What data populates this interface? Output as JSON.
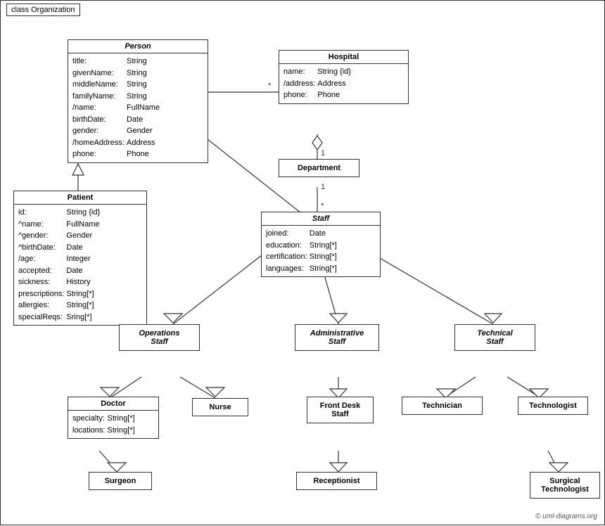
{
  "title": "class Organization",
  "copyright": "© uml-diagrams.org",
  "classes": {
    "person": {
      "name": "Person",
      "italic": true,
      "attributes": [
        [
          "title:",
          "String"
        ],
        [
          "givenName:",
          "String"
        ],
        [
          "middleName:",
          "String"
        ],
        [
          "familyName:",
          "String"
        ],
        [
          "/name:",
          "FullName"
        ],
        [
          "birthDate:",
          "Date"
        ],
        [
          "gender:",
          "Gender"
        ],
        [
          "/homeAddress:",
          "Address"
        ],
        [
          "phone:",
          "Phone"
        ]
      ]
    },
    "hospital": {
      "name": "Hospital",
      "attributes": [
        [
          "name:",
          "String {id}"
        ],
        [
          "/address:",
          "Address"
        ],
        [
          "phone:",
          "Phone"
        ]
      ]
    },
    "patient": {
      "name": "Patient",
      "attributes": [
        [
          "id:",
          "String {id}"
        ],
        [
          "^name:",
          "FullName"
        ],
        [
          "^gender:",
          "Gender"
        ],
        [
          "^birthDate:",
          "Date"
        ],
        [
          "/age:",
          "Integer"
        ],
        [
          "accepted:",
          "Date"
        ],
        [
          "sickness:",
          "History"
        ],
        [
          "prescriptions:",
          "String[*]"
        ],
        [
          "allergies:",
          "String[*]"
        ],
        [
          "specialReqs:",
          "Sring[*]"
        ]
      ]
    },
    "department": {
      "name": "Department"
    },
    "staff": {
      "name": "Staff",
      "italic": true,
      "attributes": [
        [
          "joined:",
          "Date"
        ],
        [
          "education:",
          "String[*]"
        ],
        [
          "certification:",
          "String[*]"
        ],
        [
          "languages:",
          "String[*]"
        ]
      ]
    },
    "operations_staff": {
      "name": "Operations\nStaff",
      "italic": true
    },
    "administrative_staff": {
      "name": "Administrative\nStaff",
      "italic": true
    },
    "technical_staff": {
      "name": "Technical\nStaff",
      "italic": true
    },
    "doctor": {
      "name": "Doctor",
      "attributes": [
        [
          "specialty:",
          "String[*]"
        ],
        [
          "locations:",
          "String[*]"
        ]
      ]
    },
    "nurse": {
      "name": "Nurse"
    },
    "front_desk_staff": {
      "name": "Front Desk\nStaff"
    },
    "technician": {
      "name": "Technician"
    },
    "technologist": {
      "name": "Technologist"
    },
    "surgeon": {
      "name": "Surgeon"
    },
    "receptionist": {
      "name": "Receptionist"
    },
    "surgical_technologist": {
      "name": "Surgical\nTechnologist"
    }
  }
}
